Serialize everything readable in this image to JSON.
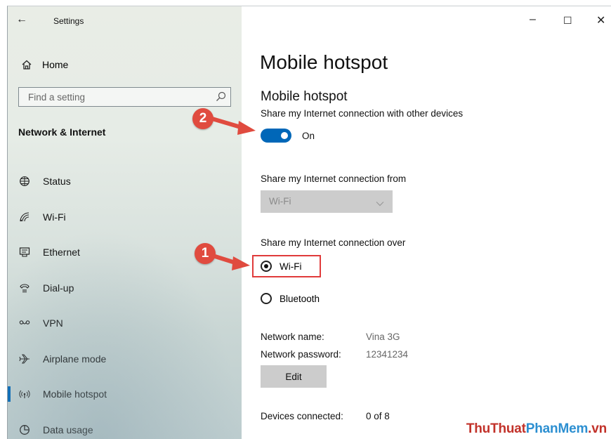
{
  "window": {
    "title": "Settings",
    "controls": {
      "minimize": "–",
      "maximize": "☐",
      "close": "✕"
    }
  },
  "sidebar": {
    "home_label": "Home",
    "search": {
      "placeholder": "Find a setting"
    },
    "section_title": "Network & Internet",
    "items": [
      {
        "label": "Status",
        "icon": "globe-icon"
      },
      {
        "label": "Wi-Fi",
        "icon": "wifi-icon"
      },
      {
        "label": "Ethernet",
        "icon": "ethernet-icon"
      },
      {
        "label": "Dial-up",
        "icon": "dialup-icon"
      },
      {
        "label": "VPN",
        "icon": "vpn-icon"
      },
      {
        "label": "Airplane mode",
        "icon": "airplane-icon"
      },
      {
        "label": "Mobile hotspot",
        "icon": "hotspot-icon",
        "active": true
      },
      {
        "label": "Data usage",
        "icon": "data-usage-icon"
      }
    ]
  },
  "main": {
    "page_title": "Mobile hotspot",
    "section_title": "Mobile hotspot",
    "share_label": "Share my Internet connection with other devices",
    "toggle_state": "On",
    "from_label": "Share my Internet connection from",
    "from_value": "Wi-Fi",
    "over_label": "Share my Internet connection over",
    "over_options": [
      {
        "label": "Wi-Fi",
        "checked": true
      },
      {
        "label": "Bluetooth",
        "checked": false
      }
    ],
    "network_name_label": "Network name:",
    "network_name_value": "Vina 3G",
    "network_password_label": "Network password:",
    "network_password_value": "12341234",
    "edit_label": "Edit",
    "devices_label": "Devices connected:",
    "devices_value": "0 of 8"
  },
  "annotations": {
    "step1": "1",
    "step2": "2",
    "color": "#e04b3f"
  },
  "watermark": {
    "part1": "ThuThuat",
    "part2": "PhanMem",
    "part3": ".vn"
  },
  "colors": {
    "accent": "#0067b8",
    "highlight": "#e03b3b"
  }
}
